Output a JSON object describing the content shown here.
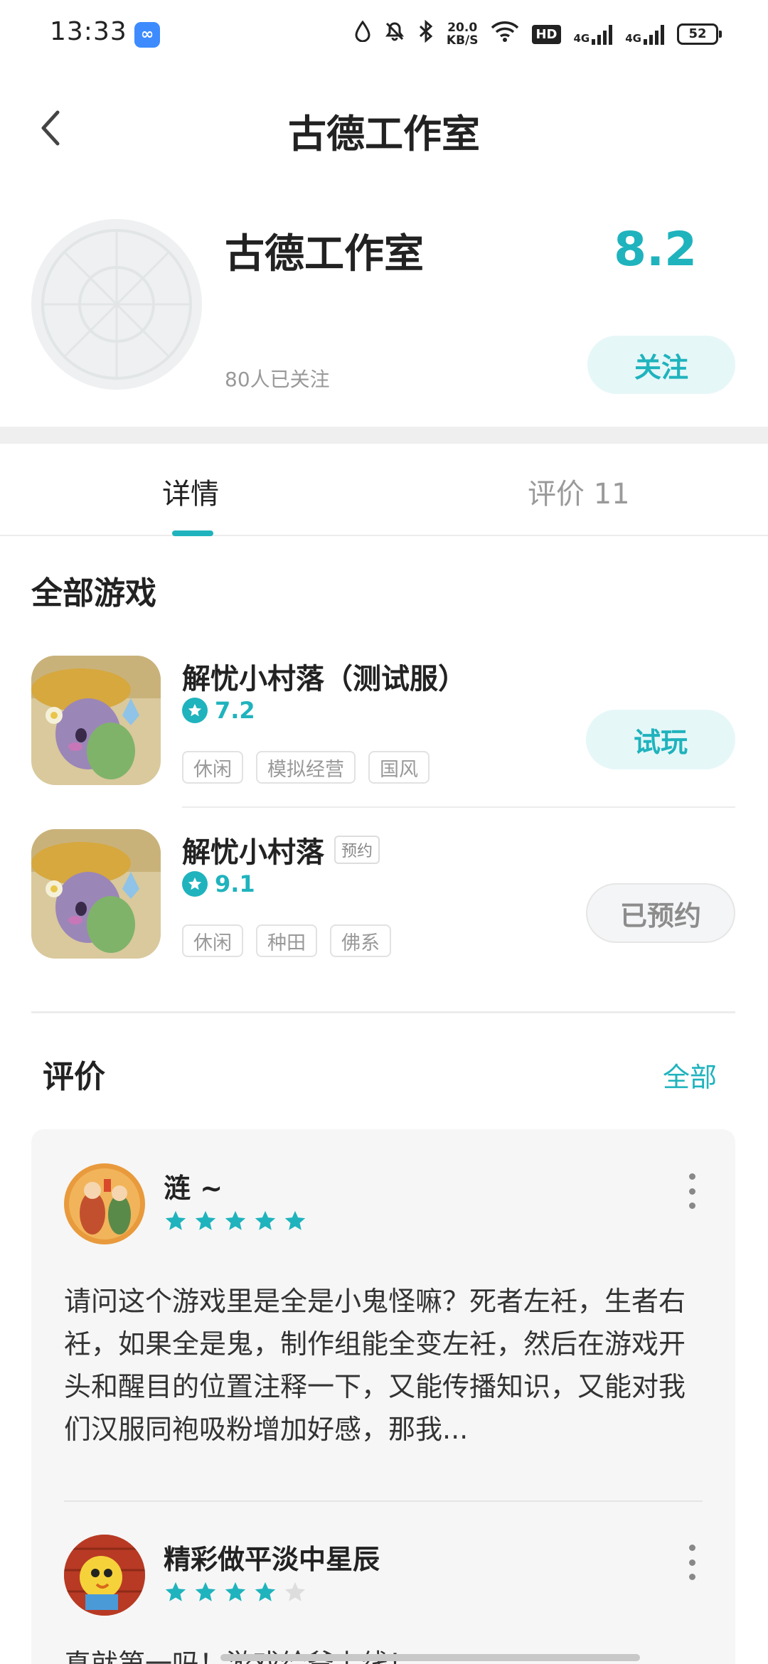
{
  "status_bar": {
    "time": "13:33",
    "speed_value": "20.0",
    "speed_unit": "KB/S",
    "hd": "HD",
    "net1": "4G",
    "net2": "4G",
    "battery": "52"
  },
  "header": {
    "title": "古德工作室"
  },
  "studio": {
    "name": "古德工作室",
    "followers": "80人已关注",
    "score": "8.2",
    "follow_label": "关注"
  },
  "tabs": [
    {
      "label": "详情"
    },
    {
      "label": "评价 11"
    }
  ],
  "games_section": {
    "title": "全部游戏",
    "games": [
      {
        "title": "解忧小村落（测试服）",
        "rating": "7.2",
        "tags": [
          "休闲",
          "模拟经营",
          "国风"
        ],
        "action": "试玩"
      },
      {
        "title": "解忧小村落",
        "badge": "预约",
        "rating": "9.1",
        "tags": [
          "休闲",
          "种田",
          "佛系"
        ],
        "action": "已预约"
      }
    ]
  },
  "reviews_section": {
    "title": "评价",
    "all_label": "全部",
    "reviews": [
      {
        "name": "涟 ~",
        "stars": 5,
        "text": "请问这个游戏里是全是小鬼怪嘛？死者左衽，生者右衽，如果全是鬼，制作组能全变左衽，然后在游戏开头和醒目的位置注释一下，又能传播知识，又能对我们汉服同袍吸粉增加好感，那我..."
      },
      {
        "name": "精彩做平淡中星辰",
        "stars": 4,
        "text": "真就第一吗！游戏给爷上线！"
      }
    ]
  },
  "colors": {
    "accent": "#1fb3bd",
    "accent_bg": "#e6f7f8",
    "star_off": "#dddddd"
  }
}
